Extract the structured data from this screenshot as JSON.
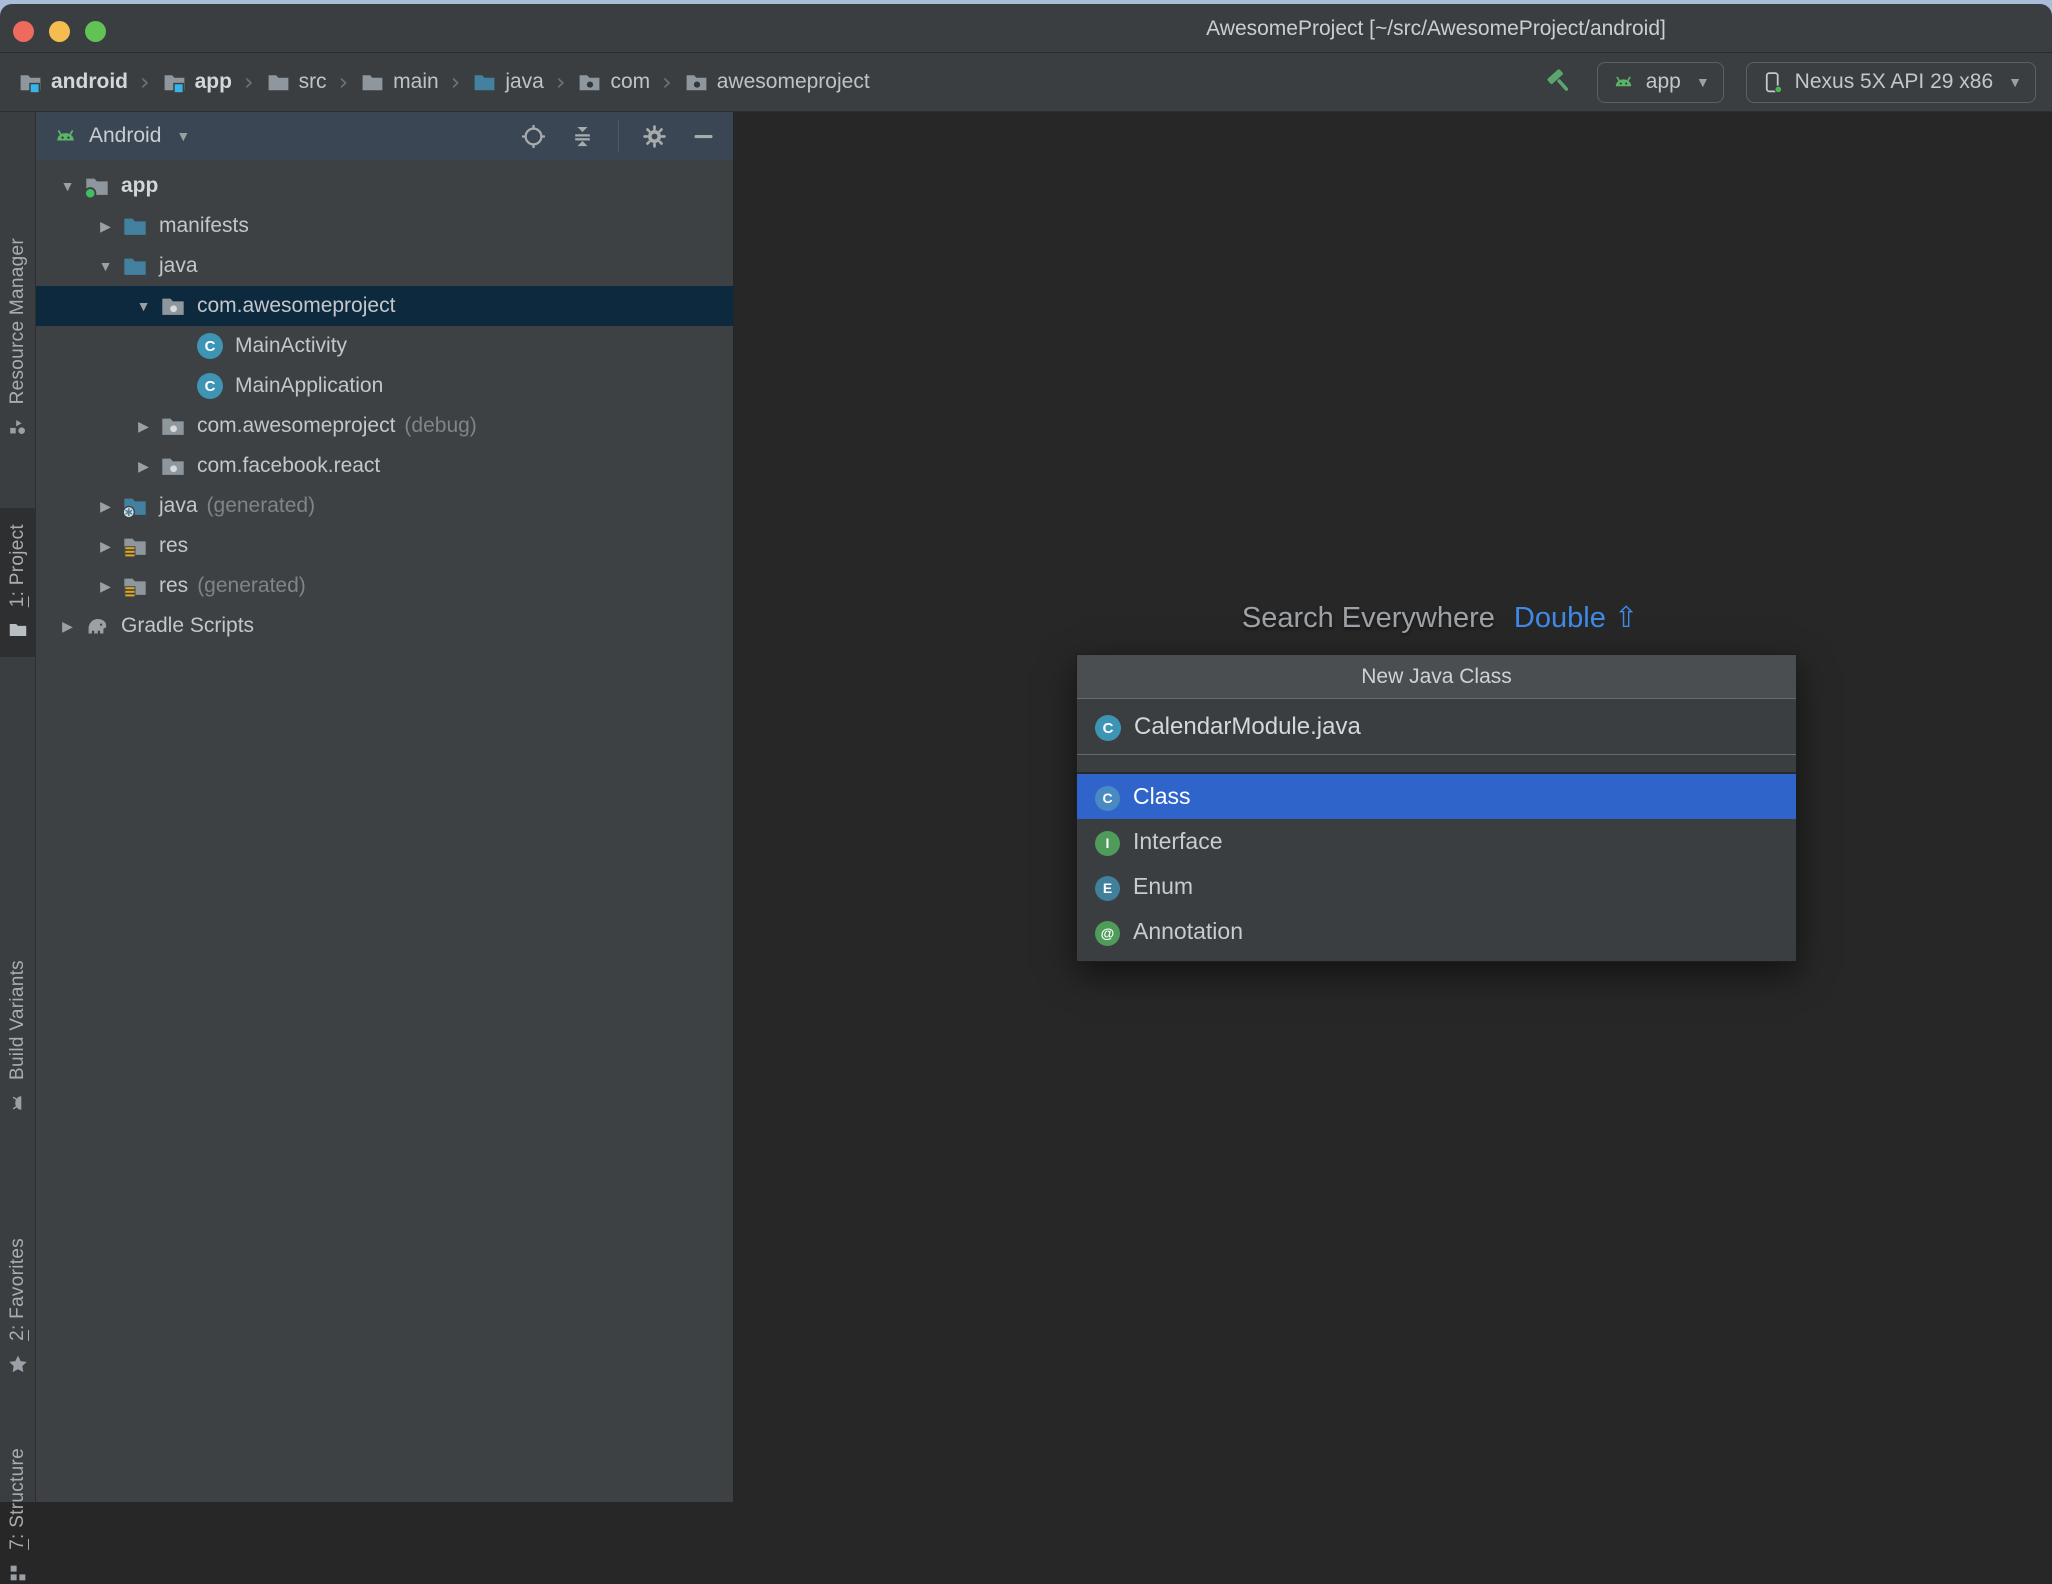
{
  "window": {
    "title": "AwesomeProject [~/src/AwesomeProject/android]"
  },
  "toolbar": {
    "separator": "›",
    "breadcrumbs": [
      {
        "label": "android",
        "icon": "module-folder",
        "bold": true
      },
      {
        "label": "app",
        "icon": "module-folder",
        "bold": true
      },
      {
        "label": "src",
        "icon": "folder"
      },
      {
        "label": "main",
        "icon": "folder"
      },
      {
        "label": "java",
        "icon": "source-folder"
      },
      {
        "label": "com",
        "icon": "package-folder"
      },
      {
        "label": "awesomeproject",
        "icon": "package-folder"
      }
    ],
    "run_config": {
      "label": "app"
    },
    "device_selector": {
      "label": "Nexus 5X API 29 x86"
    }
  },
  "tool_strip": {
    "items": [
      {
        "id": "resource-manager",
        "label": " Resource Manager",
        "icon": "resource-manager-icon"
      },
      {
        "id": "project",
        "mnemonic": "1",
        "label": ": Project",
        "icon": "project-icon",
        "active": true
      },
      {
        "id": "build-variants",
        "label": " Build Variants",
        "icon": "build-variants-icon"
      },
      {
        "id": "favorites",
        "mnemonic": "2",
        "label": ": Favorites",
        "icon": "favorites-icon"
      },
      {
        "id": "structure",
        "mnemonic": "7",
        "label": ": Structure",
        "icon": "structure-icon"
      }
    ]
  },
  "project_panel": {
    "view_selector": "Android",
    "tree": [
      {
        "name": "app",
        "icon": "module-folder",
        "level": 0,
        "arrow": "down",
        "bold": true
      },
      {
        "name": "manifests",
        "icon": "folder-teal",
        "level": 1,
        "arrow": "right"
      },
      {
        "name": "java",
        "icon": "folder-teal",
        "level": 1,
        "arrow": "down"
      },
      {
        "name": "com.awesomeproject",
        "icon": "package-folder",
        "level": 2,
        "arrow": "down",
        "selected": true
      },
      {
        "name": "MainActivity",
        "icon": "class-circle",
        "icon_letter": "C",
        "icon_color": "#3d94b4",
        "level": 3
      },
      {
        "name": "MainApplication",
        "icon": "class-circle",
        "icon_letter": "C",
        "icon_color": "#3d94b4",
        "level": 3
      },
      {
        "name": "com.awesomeproject",
        "suffix": "(debug)",
        "icon": "package-folder",
        "level": 2,
        "arrow": "right"
      },
      {
        "name": "com.facebook.react",
        "icon": "package-folder",
        "level": 2,
        "arrow": "right"
      },
      {
        "name": "java",
        "suffix": "(generated)",
        "icon": "generated-folder",
        "level": 1,
        "arrow": "right"
      },
      {
        "name": "res",
        "icon": "res-folder",
        "level": 1,
        "arrow": "right"
      },
      {
        "name": "res",
        "suffix": "(generated)",
        "icon": "res-folder",
        "level": 1,
        "arrow": "right"
      },
      {
        "name": "Gradle Scripts",
        "icon": "gradle-elephant",
        "level": 0,
        "arrow": "right"
      }
    ]
  },
  "editor": {
    "hint": {
      "action": "Search Everywhere",
      "shortcut": "Double",
      "shortcut_symbol": "⇧"
    }
  },
  "popup": {
    "title": "New Java Class",
    "filename": "CalendarModule.java",
    "filename_icon_letter": "C",
    "filename_icon_color": "#3d94b4",
    "options": [
      {
        "label": "Class",
        "icon_letter": "C",
        "icon_color": "#4a8ac2",
        "selected": true
      },
      {
        "label": "Interface",
        "icon_letter": "I",
        "icon_color": "#4f9b59"
      },
      {
        "label": "Enum",
        "icon_letter": "E",
        "icon_color": "#41809b"
      },
      {
        "label": "Annotation",
        "icon_letter": "@",
        "icon_color": "#4f9b59"
      }
    ]
  },
  "glyphs": {
    "expanded": "▼",
    "collapsed": "▶",
    "dropdown": "▼",
    "star": "★"
  },
  "icon_colors": {
    "folder_gray": "#8f979e",
    "folder_teal": "#44809f",
    "module_badge_green": "#3fbf63",
    "breadcrumb_badge_blue": "#36b3e8",
    "res_badge_yellow": "#e0a71c",
    "android_green": "#5cb567",
    "hammer_green": "#5aa570",
    "device_dot_green": "#49b64f",
    "accent_blue": "#3f8ae8",
    "selection_blue": "#2f65ca",
    "tree_selection_navy": "#0d293e",
    "panel_header_bg": "#3a4653",
    "titlebar_bg": "#3b3e40",
    "editor_bg": "#272727",
    "traffic_red": "#ee6a5f",
    "traffic_yellow": "#f5bd4f",
    "traffic_green": "#61c354"
  }
}
